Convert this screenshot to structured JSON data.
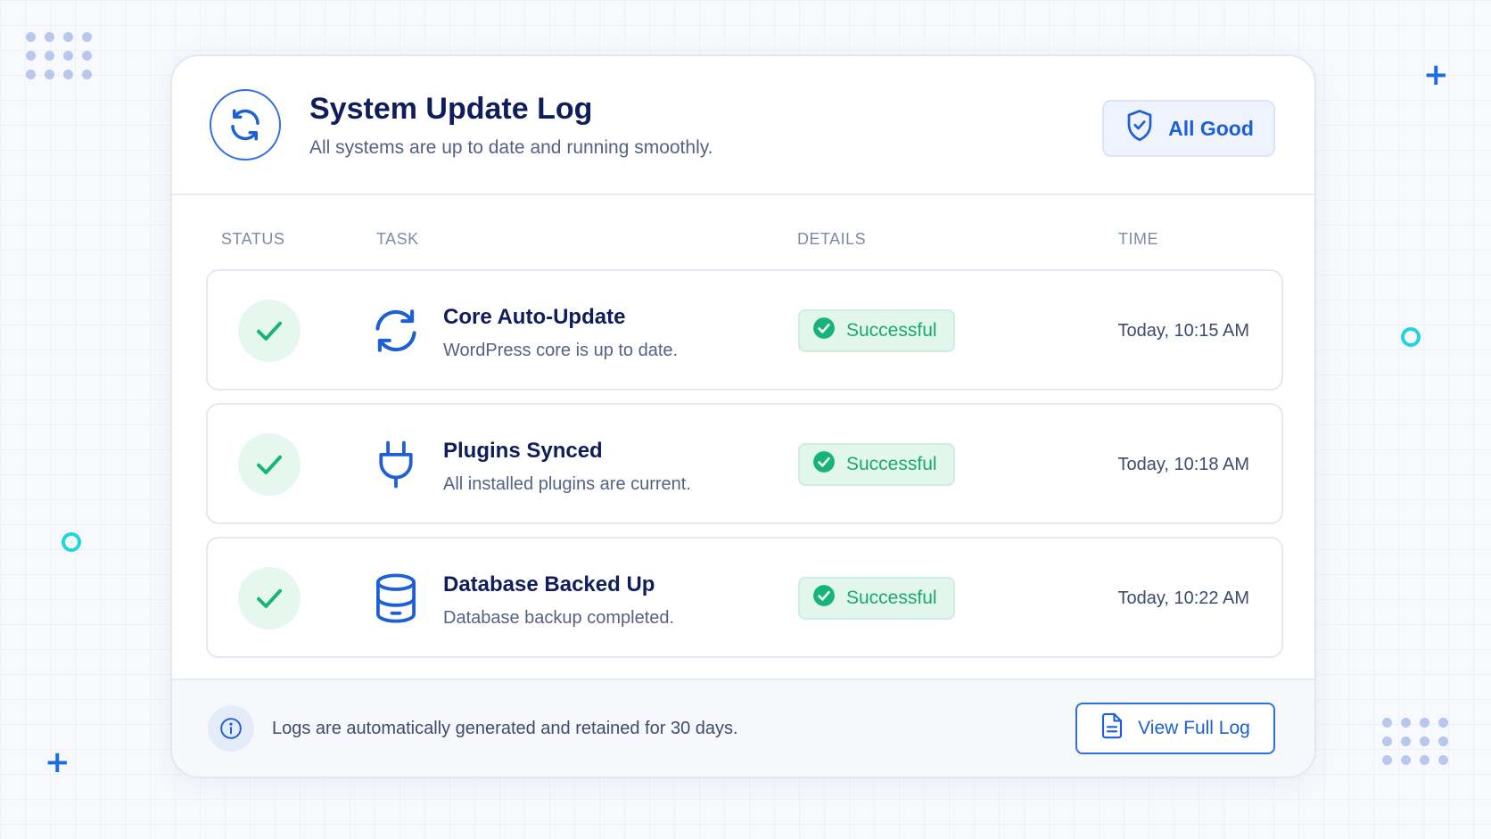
{
  "header": {
    "title": "System Update Log",
    "subtitle": "All systems are up to date and running smoothly.",
    "status_label": "All Good",
    "icon": "refresh-icon",
    "status_icon": "shield-check-icon"
  },
  "columns": {
    "status": "STATUS",
    "task": "TASK",
    "details": "DETAILS",
    "time": "TIME"
  },
  "rows": [
    {
      "icon": "sync-icon",
      "title": "Core Auto-Update",
      "description": "WordPress core is up to date.",
      "status": "Successful",
      "time": "Today, 10:15 AM"
    },
    {
      "icon": "plug-icon",
      "title": "Plugins Synced",
      "description": "All installed plugins are current.",
      "status": "Successful",
      "time": "Today, 10:18 AM"
    },
    {
      "icon": "database-icon",
      "title": "Database Backed Up",
      "description": "Database backup completed.",
      "status": "Successful",
      "time": "Today, 10:22 AM"
    }
  ],
  "footer": {
    "note": "Logs are automatically generated and retained for 30 days.",
    "button_label": "View Full Log",
    "info_icon": "info-icon",
    "button_icon": "document-icon"
  },
  "colors": {
    "accent": "#1d5fd6",
    "success": "#17a874",
    "title": "#0f1d5c",
    "decor_cyan": "#22d3e6"
  }
}
